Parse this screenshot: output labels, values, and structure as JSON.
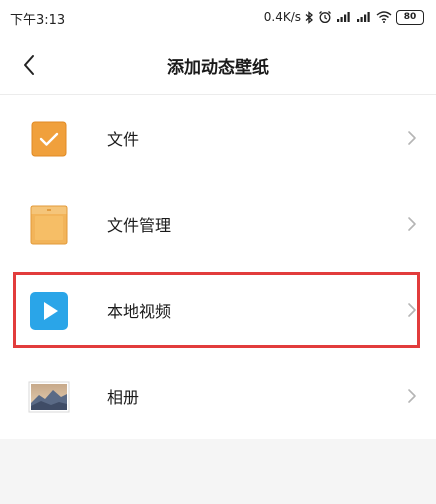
{
  "status_bar": {
    "time": "下午3:13",
    "network_speed": "0.4K/s",
    "battery": "80",
    "icons": [
      "bluetooth-icon",
      "alarm-icon",
      "signal-icon",
      "signal-icon",
      "wifi-icon",
      "battery-icon"
    ]
  },
  "header": {
    "title": "添加动态壁纸",
    "back_icon": "chevron-left-icon"
  },
  "items": [
    {
      "label": "文件",
      "icon": "file-checkbox-icon"
    },
    {
      "label": "文件管理",
      "icon": "file-manager-icon"
    },
    {
      "label": "本地视频",
      "icon": "play-video-icon",
      "highlighted": true
    },
    {
      "label": "相册",
      "icon": "gallery-icon"
    }
  ],
  "colors": {
    "accent_orange": "#f0a03c",
    "video_blue": "#2aa5e8",
    "highlight_red": "#e23c3c",
    "background": "#f5f5f5"
  }
}
